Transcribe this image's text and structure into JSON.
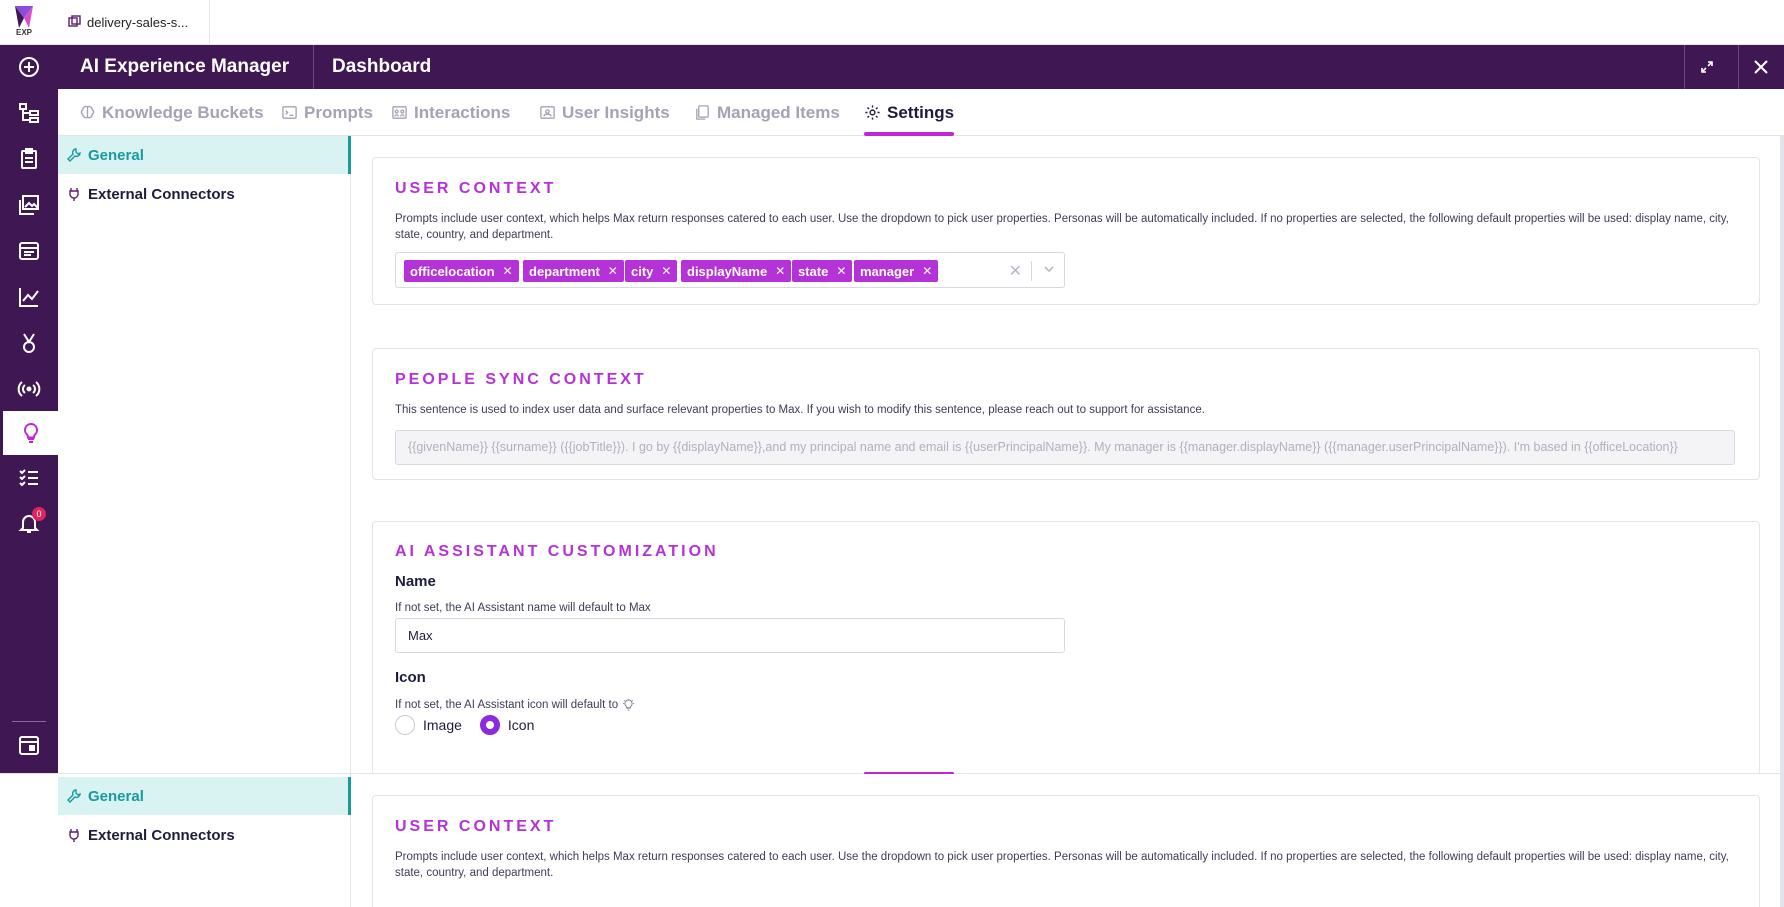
{
  "brand": {
    "logo_text": "EXP"
  },
  "doc_tab": {
    "label": "delivery-sales-s..."
  },
  "header": {
    "app_title": "AI Experience Manager",
    "page_title": "Dashboard"
  },
  "rail": {
    "icons": [
      "add-circle-icon",
      "hierarchy-icon",
      "clipboard-icon",
      "gallery-icon",
      "news-icon",
      "analytics-icon",
      "badge-icon",
      "broadcast-icon",
      "lightbulb-icon",
      "checklist-icon",
      "bell-icon",
      "calendar-icon"
    ],
    "notification_count": "0"
  },
  "tabs": [
    {
      "label": "Knowledge Buckets",
      "icon": "brain-icon"
    },
    {
      "label": "Prompts",
      "icon": "terminal-icon"
    },
    {
      "label": "Interactions",
      "icon": "interactions-icon"
    },
    {
      "label": "User Insights",
      "icon": "users-icon"
    },
    {
      "label": "Managed Items",
      "icon": "copy-icon"
    },
    {
      "label": "Settings",
      "icon": "gear-icon"
    }
  ],
  "settings_nav": [
    {
      "label": "General",
      "icon": "wrench-icon"
    },
    {
      "label": "External Connectors",
      "icon": "plug-icon"
    }
  ],
  "user_context": {
    "title": "USER CONTEXT",
    "description": "Prompts include user context, which helps Max return responses catered to each user. Use the dropdown to pick user properties. Personas will be automatically included. If no properties are selected, the following default properties will be used: display name, city, state, country, and department.",
    "chips": [
      "officelocation",
      "department",
      "city",
      "displayName",
      "state",
      "manager"
    ]
  },
  "people_sync": {
    "title": "PEOPLE SYNC CONTEXT",
    "description": "This sentence is used to index user data and surface relevant properties to Max. If you wish to modify this sentence, please reach out to support for assistance.",
    "sentence": "{{givenName}} {{surname}} ({{jobTitle}}). I go by {{displayName}},and my principal name and email is {{userPrincipalName}}. My manager is {{manager.displayName}} ({{manager.userPrincipalName}}). I'm based in {{officeLocation}}"
  },
  "assistant": {
    "title": "AI ASSISTANT CUSTOMIZATION",
    "name_label": "Name",
    "name_hint": "If not set, the AI Assistant name will default to Max",
    "name_value": "Max",
    "icon_label": "Icon",
    "icon_hint": "If not set, the AI Assistant icon will default to",
    "radio_image": "Image",
    "radio_icon": "Icon"
  }
}
